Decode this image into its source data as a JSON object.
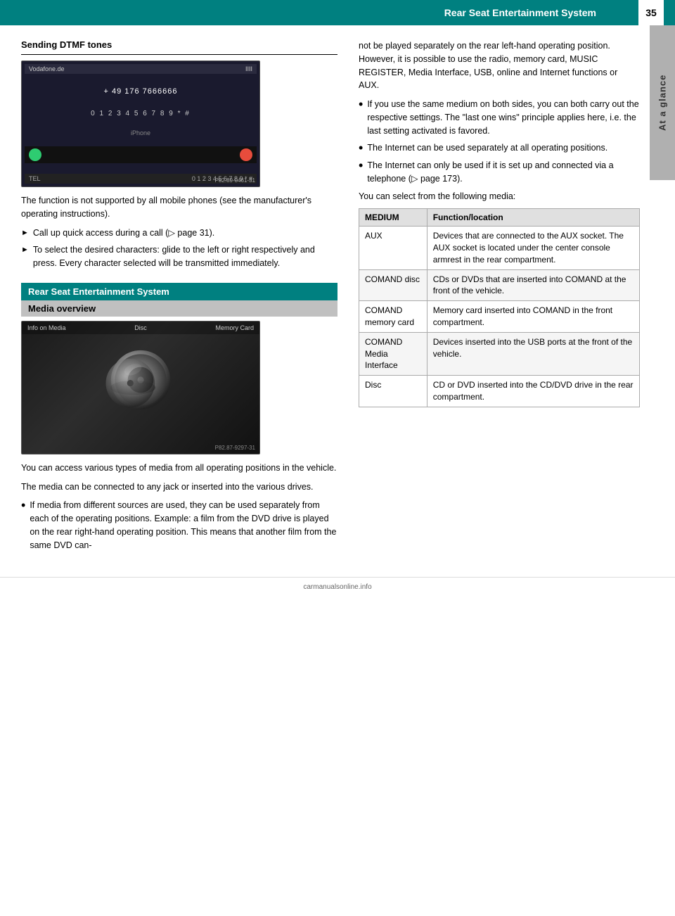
{
  "header": {
    "title": "Rear Seat Entertainment System",
    "page_number": "35"
  },
  "sidebar": {
    "label": "At a glance"
  },
  "left_section": {
    "heading": "Sending DTMF tones",
    "phone_screen": {
      "carrier": "Vodafone.de",
      "signal": "IIII",
      "number": "+ 49 176 7666666",
      "keypad": "0 1 2 3 4 5 6 7 8 9 * #",
      "label": "iPhone",
      "tel_label": "TEL",
      "tel_keys": "0 1 2 3 4 5 6 7 8 9 * #",
      "caption": "P82.89-0461-31"
    },
    "body_text": "The function is not supported by all mobile phones (see the manufacturer's operating instructions).",
    "bullets": [
      {
        "type": "arrow",
        "text": "Call up quick access during a call (▷ page 31)."
      },
      {
        "type": "arrow",
        "text": "To select the desired characters: glide to the left or right respectively and press. Every character selected will be transmitted immediately."
      }
    ],
    "teal_banner": "Rear Seat Entertainment System",
    "gray_banner": "Media overview",
    "media_screen": {
      "left_label": "Info on Media",
      "center_label": "Disc",
      "right_label": "Memory Card",
      "caption": "P82.87-9297-31"
    },
    "media_body1": "You can access various types of media from all operating positions in the vehicle.",
    "media_body2": "The media can be connected to any jack or inserted into the various drives.",
    "media_bullet": "If media from different sources are used, they can be used separately from each of the operating positions. Example: a film from the DVD drive is played on the rear right-hand operating position. This means that another film from the same DVD can-"
  },
  "right_section": {
    "continuation_text": "not be played separately on the rear left-hand operating position. However, it is possible to use the radio, memory card, MUSIC REGISTER, Media Interface, USB, online and Internet functions or AUX.",
    "bullets": [
      {
        "text": "If you use the same medium on both sides, you can both carry out the respective settings. The \"last one wins\" principle applies here, i.e. the last setting activated is favored."
      },
      {
        "text": "The Internet can be used separately at all operating positions."
      },
      {
        "text": "The Internet can only be used if it is set up and connected via a telephone (▷ page 173)."
      }
    ],
    "select_media_text": "You can select from the following media:",
    "table": {
      "headers": [
        "MEDIUM",
        "Function/location"
      ],
      "rows": [
        {
          "medium": "AUX",
          "function": "Devices that are connected to the AUX socket. The AUX socket is located under the center console armrest in the rear compartment."
        },
        {
          "medium": "COMAND disc",
          "function": "CDs or DVDs that are inserted into COMAND at the front of the vehicle."
        },
        {
          "medium": "COMAND memory card",
          "function": "Memory card inserted into COMAND in the front compartment."
        },
        {
          "medium": "COMAND Media Interface",
          "function": "Devices inserted into the USB ports at the front of the vehicle."
        },
        {
          "medium": "Disc",
          "function": "CD or DVD inserted into the CD/DVD drive in the rear compartment."
        }
      ]
    }
  },
  "footer": {
    "link": "carmanualsonline.info"
  }
}
